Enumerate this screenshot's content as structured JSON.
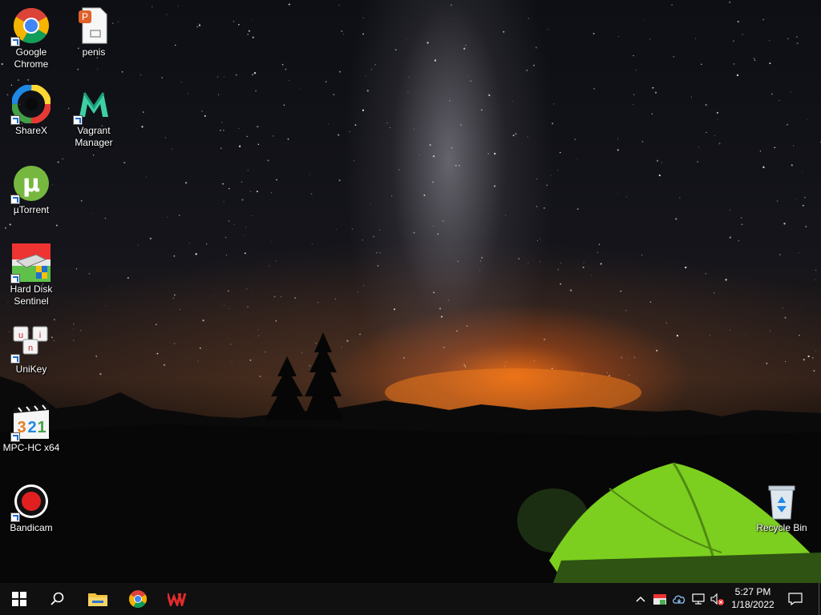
{
  "desktop": {
    "icons": [
      {
        "label_line1": "Google",
        "label_line2": "Chrome",
        "icon": "chrome-icon"
      },
      {
        "label_line1": "penis",
        "icon": "presentation-file-icon"
      },
      {
        "label_line1": "ShareX",
        "icon": "sharex-icon"
      },
      {
        "label_line1": "Vagrant",
        "label_line2": "Manager",
        "icon": "vagrant-manager-icon"
      },
      {
        "label_line1": "µTorrent",
        "icon": "utorrent-icon"
      },
      {
        "label_line1": "Hard Disk",
        "label_line2": "Sentinel",
        "icon": "hard-disk-icon"
      },
      {
        "label_line1": "UniKey",
        "icon": "unikey-icon"
      },
      {
        "label_line1": "MPC-HC x64",
        "icon": "media-player-icon"
      },
      {
        "label_line1": "Bandicam",
        "icon": "record-icon"
      },
      {
        "label_line1": "Recycle Bin",
        "icon": "recycle-bin-icon"
      }
    ]
  },
  "taskbar": {
    "start": "windows-logo-icon",
    "search": "search-icon",
    "pinned": [
      "folder-icon",
      "chrome-icon",
      "wps-office-icon"
    ],
    "tray": [
      "chevron-up-icon",
      "app-tray-icon",
      "cloud-icon",
      "network-icon",
      "speaker-muted-icon"
    ],
    "clock": {
      "time": "5:27 PM",
      "date": "1/18/2022"
    },
    "notifications": "notification-icon"
  },
  "colors": {
    "taskbar": "#101010",
    "tent": "#7ccf1e",
    "sunset": "#e8731a"
  }
}
